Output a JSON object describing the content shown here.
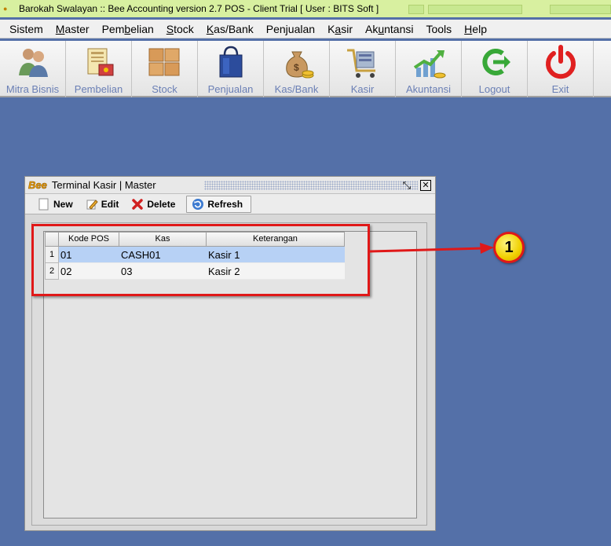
{
  "window": {
    "title": "Barokah Swalayan :: Bee Accounting version 2.7 POS - Client Trial [ User : BITS Soft ]"
  },
  "menu": [
    {
      "label": "Sistem",
      "key": "y"
    },
    {
      "label": "Master",
      "key": "M"
    },
    {
      "label": "Pembelian",
      "key": "b"
    },
    {
      "label": "Stock",
      "key": "S"
    },
    {
      "label": "Kas/Bank",
      "key": "K"
    },
    {
      "label": "Penjualan",
      "key": "j"
    },
    {
      "label": "Kasir",
      "key": "a"
    },
    {
      "label": "Akuntansi",
      "key": "u"
    },
    {
      "label": "Tools",
      "key": ""
    },
    {
      "label": "Help",
      "key": "H"
    }
  ],
  "toolbar": [
    {
      "label": "Mitra Bisnis",
      "icon": "users-icon"
    },
    {
      "label": "Pembelian",
      "icon": "purchase-icon"
    },
    {
      "label": "Stock",
      "icon": "boxes-icon"
    },
    {
      "label": "Penjualan",
      "icon": "shopping-bag-icon"
    },
    {
      "label": "Kas/Bank",
      "icon": "money-bag-icon"
    },
    {
      "label": "Kasir",
      "icon": "cashier-cart-icon"
    },
    {
      "label": "Akuntansi",
      "icon": "growth-chart-icon"
    },
    {
      "label": "Logout",
      "icon": "logout-icon"
    },
    {
      "label": "Exit",
      "icon": "power-icon"
    }
  ],
  "inner_window": {
    "logo": "Bee",
    "title": "Terminal Kasir | Master",
    "buttons": {
      "new": "New",
      "edit": "Edit",
      "delete": "Delete",
      "refresh": "Refresh"
    }
  },
  "grid": {
    "columns": [
      "Kode POS",
      "Kas",
      "Keterangan"
    ],
    "rows": [
      {
        "num": "1",
        "kode_pos": "01",
        "kas": "CASH01",
        "keterangan": "Kasir 1"
      },
      {
        "num": "2",
        "kode_pos": "02",
        "kas": "03",
        "keterangan": "Kasir 2"
      }
    ]
  },
  "annotation": {
    "badge": "1"
  },
  "colors": {
    "desktop": "#5470a8",
    "titlebar": "#d8f0a0",
    "selected_row": "#b7d1f5",
    "annotation_red": "#e01818",
    "badge_yellow": "#f0d000",
    "toolbar_label": "#6a7fb5"
  }
}
